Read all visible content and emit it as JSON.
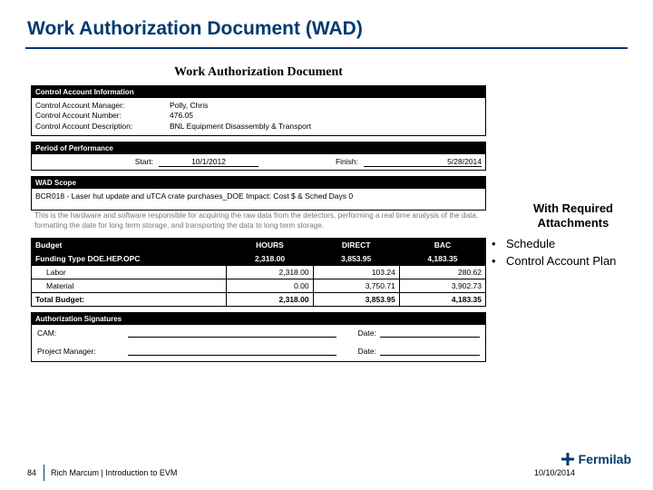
{
  "slide": {
    "title": "Work Authorization Document (WAD)"
  },
  "wad": {
    "heading": "Work Authorization Document",
    "section_account": {
      "title": "Control Account Information",
      "rows": {
        "manager_label": "Control Account Manager:",
        "manager_value": "Polly, Chris",
        "number_label": "Control Account Number:",
        "number_value": "476.05",
        "desc_label": "Control Account Description:",
        "desc_value": "BNL Equipment Disassembly & Transport"
      }
    },
    "section_period": {
      "title": "Period of Performance",
      "start_label": "Start:",
      "start_value": "10/1/2012",
      "finish_label": "Finish:",
      "finish_value": "5/28/2014"
    },
    "section_scope": {
      "title": "WAD Scope",
      "bcr_line": "BCR018 - Laser hut update and uTCA crate purchases_DOE Impact: Cost $ & Sched Days 0",
      "description": "This is the hardware and software responsible for acquiring the raw data from the detectors, performing a real time analysis of the data, formatting the date for long term storage, and transporting the data to long term storage."
    },
    "section_budget": {
      "title": "Budget",
      "headers": {
        "h1": "Funding Type DOE.HEP.OPC",
        "h2": "HOURS",
        "h3": "DIRECT",
        "h4": "BAC"
      },
      "rows": [
        {
          "label": "Labor",
          "hours": "2,318.00",
          "direct": "3,853.95",
          "bac": "4,183.35",
          "bold": true
        },
        {
          "label": "Labor",
          "hours": "2,318.00",
          "direct": "103.24",
          "bac": "280.62"
        },
        {
          "label": "Material",
          "hours": "0.00",
          "direct": "3,750.71",
          "bac": "3,902.73"
        },
        {
          "label": "Total Budget:",
          "hours": "2,318.00",
          "direct": "3,853.95",
          "bac": "4,183.35",
          "bold": true
        }
      ]
    },
    "section_sign": {
      "title": "Authorization Signatures",
      "cam_label": "CAM:",
      "pm_label": "Project Manager:",
      "date_label": "Date:"
    }
  },
  "attachments": {
    "title_line1": "With Required",
    "title_line2": "Attachments",
    "items": [
      "Schedule",
      "Control Account Plan"
    ]
  },
  "footer": {
    "page": "84",
    "presenter": "Rich Marcum | Introduction to EVM",
    "date": "10/10/2014",
    "logo_text": "Fermilab"
  }
}
